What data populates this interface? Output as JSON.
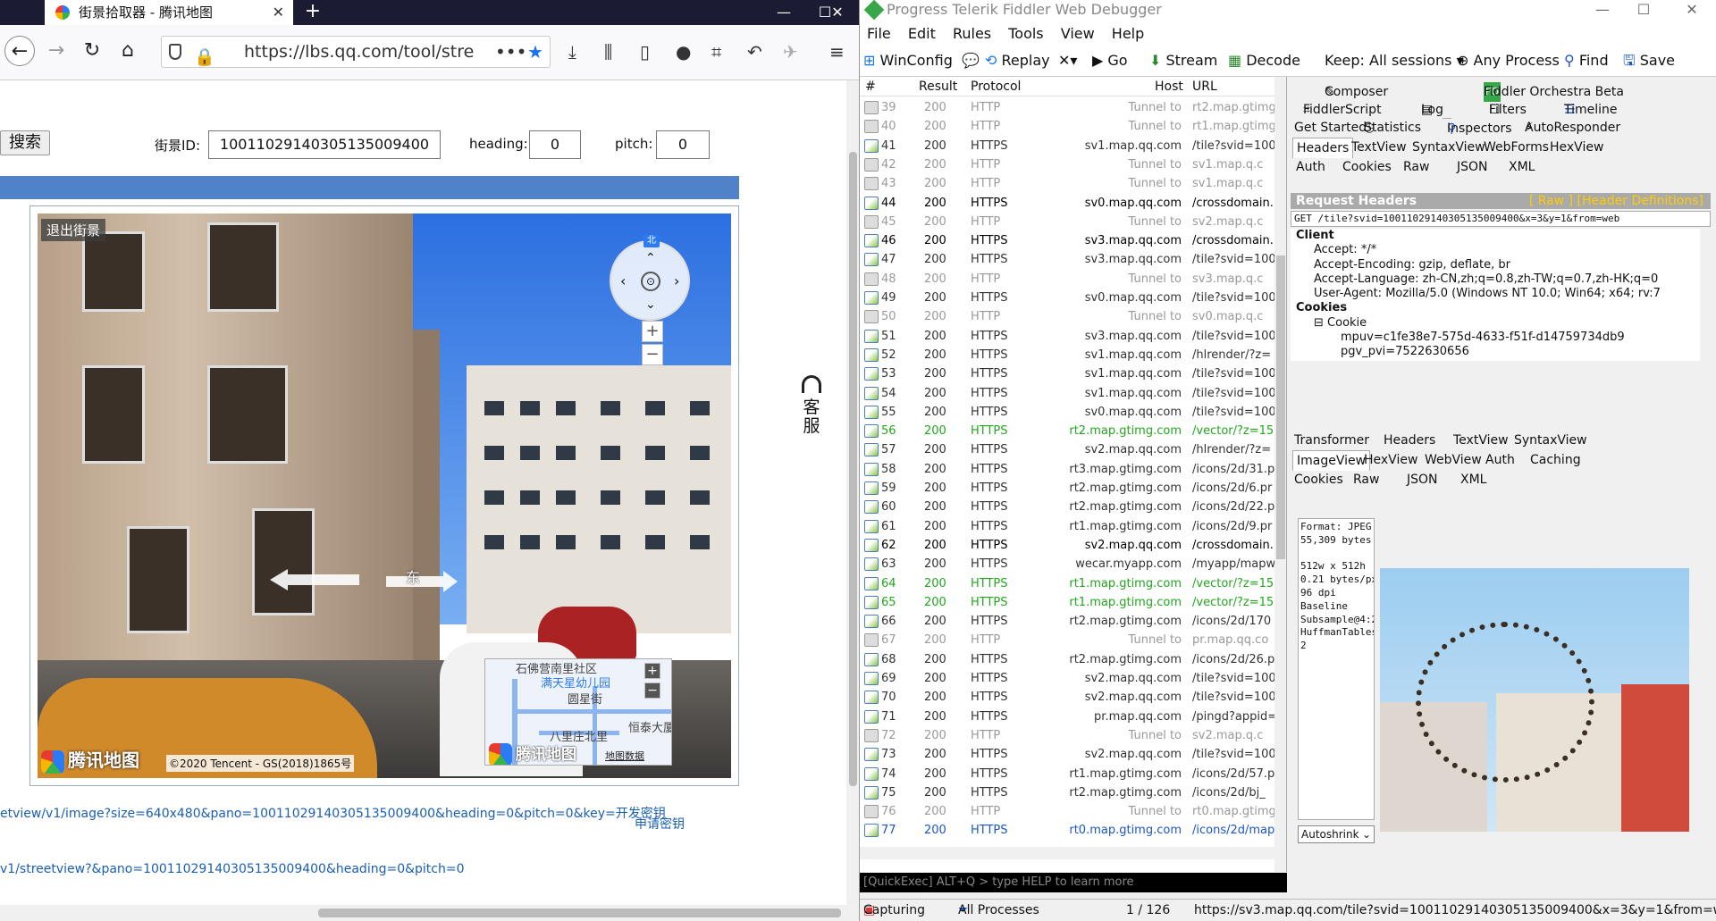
{
  "firefox": {
    "tab_title": "街景拾取器 - 腾讯地图",
    "url": "https://lbs.qq.com/tool/stre",
    "search_button": "搜索",
    "pano_id_label": "街景ID:",
    "pano_id_value": "10011029140305135009400",
    "heading_label": "heading:",
    "heading_value": "0",
    "pitch_label": "pitch:",
    "pitch_value": "0",
    "exit_streetview": "退出街景",
    "compass_north": "北",
    "direction_label": "东",
    "minimap_labels": [
      "石佛营南里社区",
      "满天星幼儿园",
      "圆星街",
      "八里庄北里",
      "恒泰大厦"
    ],
    "minimap_logo": "腾讯地图",
    "minimap_data": "地图数据",
    "pano_logo": "腾讯地图",
    "copyright": "©2020 Tencent - GS(2018)1865号",
    "kefu": "客服",
    "link_image": "etview/v1/image?size=640x480&pano=10011029140305135009400&heading=0&pitch=0&key=开发密钥",
    "link_apply": "申请密钥",
    "link_streetview": "v1/streetview?&pano=10011029140305135009400&heading=0&pitch=0"
  },
  "fiddler": {
    "title": "Progress Telerik Fiddler Web Debugger",
    "menu": [
      "File",
      "Edit",
      "Rules",
      "Tools",
      "View",
      "Help"
    ],
    "toolbar": {
      "winconfig": "WinConfig",
      "replay": "Replay",
      "go": "Go",
      "stream": "Stream",
      "decode": "Decode",
      "keep": "Keep: All sessions",
      "any_process": "Any Process",
      "find": "Find",
      "save": "Save"
    },
    "columns": [
      "#",
      "Result",
      "Protocol",
      "Host",
      "URL"
    ],
    "sessions": [
      {
        "n": "39",
        "r": "200",
        "p": "HTTP",
        "h": "Tunnel to",
        "u": "rt2.map.gtimg",
        "k": "t"
      },
      {
        "n": "40",
        "r": "200",
        "p": "HTTP",
        "h": "Tunnel to",
        "u": "rt1.map.gtimg",
        "k": "t"
      },
      {
        "n": "41",
        "r": "200",
        "p": "HTTPS",
        "h": "sv1.map.qq.com",
        "u": "/tile?svid=100",
        "k": "n"
      },
      {
        "n": "42",
        "r": "200",
        "p": "HTTP",
        "h": "Tunnel to",
        "u": "sv1.map.q.c",
        "k": "t"
      },
      {
        "n": "43",
        "r": "200",
        "p": "HTTP",
        "h": "Tunnel to",
        "u": "sv1.map.q.c",
        "k": "t"
      },
      {
        "n": "44",
        "r": "200",
        "p": "HTTPS",
        "h": "sv0.map.qq.com",
        "u": "/crossdomain.",
        "k": "b"
      },
      {
        "n": "45",
        "r": "200",
        "p": "HTTP",
        "h": "Tunnel to",
        "u": "sv2.map.q.c",
        "k": "t"
      },
      {
        "n": "46",
        "r": "200",
        "p": "HTTPS",
        "h": "sv3.map.qq.com",
        "u": "/crossdomain.",
        "k": "b"
      },
      {
        "n": "47",
        "r": "200",
        "p": "HTTPS",
        "h": "sv3.map.qq.com",
        "u": "/tile?svid=100",
        "k": "n"
      },
      {
        "n": "48",
        "r": "200",
        "p": "HTTP",
        "h": "Tunnel to",
        "u": "sv3.map.q.c",
        "k": "t"
      },
      {
        "n": "49",
        "r": "200",
        "p": "HTTPS",
        "h": "sv0.map.qq.com",
        "u": "/tile?svid=100",
        "k": "n"
      },
      {
        "n": "50",
        "r": "200",
        "p": "HTTP",
        "h": "Tunnel to",
        "u": "sv0.map.q.c",
        "k": "t"
      },
      {
        "n": "51",
        "r": "200",
        "p": "HTTPS",
        "h": "sv3.map.qq.com",
        "u": "/tile?svid=100",
        "k": "n"
      },
      {
        "n": "52",
        "r": "200",
        "p": "HTTPS",
        "h": "sv1.map.qq.com",
        "u": "/hlrender/?z=",
        "k": "n"
      },
      {
        "n": "53",
        "r": "200",
        "p": "HTTPS",
        "h": "sv1.map.qq.com",
        "u": "/tile?svid=100",
        "k": "n"
      },
      {
        "n": "54",
        "r": "200",
        "p": "HTTPS",
        "h": "sv1.map.qq.com",
        "u": "/tile?svid=100",
        "k": "n"
      },
      {
        "n": "55",
        "r": "200",
        "p": "HTTPS",
        "h": "sv0.map.qq.com",
        "u": "/tile?svid=100",
        "k": "n"
      },
      {
        "n": "56",
        "r": "200",
        "p": "HTTPS",
        "h": "rt2.map.gtimg.com",
        "u": "/vector/?z=15",
        "k": "g"
      },
      {
        "n": "57",
        "r": "200",
        "p": "HTTPS",
        "h": "sv2.map.qq.com",
        "u": "/hlrender/?z=",
        "k": "n"
      },
      {
        "n": "58",
        "r": "200",
        "p": "HTTPS",
        "h": "rt3.map.gtimg.com",
        "u": "/icons/2d/31.p",
        "k": "n"
      },
      {
        "n": "59",
        "r": "200",
        "p": "HTTPS",
        "h": "rt2.map.gtimg.com",
        "u": "/icons/2d/6.pr",
        "k": "n"
      },
      {
        "n": "60",
        "r": "200",
        "p": "HTTPS",
        "h": "rt2.map.gtimg.com",
        "u": "/icons/2d/22.p",
        "k": "n"
      },
      {
        "n": "61",
        "r": "200",
        "p": "HTTPS",
        "h": "rt1.map.gtimg.com",
        "u": "/icons/2d/9.pr",
        "k": "n"
      },
      {
        "n": "62",
        "r": "200",
        "p": "HTTPS",
        "h": "sv2.map.qq.com",
        "u": "/crossdomain.",
        "k": "b"
      },
      {
        "n": "63",
        "r": "200",
        "p": "HTTPS",
        "h": "wecar.myapp.com",
        "u": "/myapp/mapw",
        "k": "n"
      },
      {
        "n": "64",
        "r": "200",
        "p": "HTTPS",
        "h": "rt1.map.gtimg.com",
        "u": "/vector/?z=15",
        "k": "g"
      },
      {
        "n": "65",
        "r": "200",
        "p": "HTTPS",
        "h": "rt1.map.gtimg.com",
        "u": "/vector/?z=15",
        "k": "g"
      },
      {
        "n": "66",
        "r": "200",
        "p": "HTTPS",
        "h": "rt2.map.gtimg.com",
        "u": "/icons/2d/170",
        "k": "n"
      },
      {
        "n": "67",
        "r": "200",
        "p": "HTTP",
        "h": "Tunnel to",
        "u": "pr.map.qq.co",
        "k": "t"
      },
      {
        "n": "68",
        "r": "200",
        "p": "HTTPS",
        "h": "rt2.map.gtimg.com",
        "u": "/icons/2d/26.p",
        "k": "n"
      },
      {
        "n": "69",
        "r": "200",
        "p": "HTTPS",
        "h": "sv2.map.qq.com",
        "u": "/tile?svid=100",
        "k": "n"
      },
      {
        "n": "70",
        "r": "200",
        "p": "HTTPS",
        "h": "sv2.map.qq.com",
        "u": "/tile?svid=100",
        "k": "n"
      },
      {
        "n": "71",
        "r": "200",
        "p": "HTTPS",
        "h": "pr.map.qq.com",
        "u": "/pingd?appid=",
        "k": "n"
      },
      {
        "n": "72",
        "r": "200",
        "p": "HTTP",
        "h": "Tunnel to",
        "u": "sv2.map.q.c",
        "k": "t"
      },
      {
        "n": "73",
        "r": "200",
        "p": "HTTPS",
        "h": "sv2.map.qq.com",
        "u": "/tile?svid=100",
        "k": "n"
      },
      {
        "n": "74",
        "r": "200",
        "p": "HTTPS",
        "h": "rt1.map.gtimg.com",
        "u": "/icons/2d/57.p",
        "k": "n"
      },
      {
        "n": "75",
        "r": "200",
        "p": "HTTPS",
        "h": "rt2.map.gtimg.com",
        "u": "/icons/2d/bj_",
        "k": "n"
      },
      {
        "n": "76",
        "r": "200",
        "p": "HTTP",
        "h": "Tunnel to",
        "u": "rt0.map.gtimg",
        "k": "t"
      },
      {
        "n": "77",
        "r": "200",
        "p": "HTTPS",
        "h": "rt0.map.gtimg.com",
        "u": "/icons/2d/map",
        "k": "sel"
      }
    ],
    "quickexec": "[QuickExec] ALT+Q > type HELP to learn more",
    "status": {
      "capturing": "Capturing",
      "processes": "All Processes",
      "count": "1 / 126",
      "url": "https://sv3.map.qq.com/tile?svid=10011029140305135009400&x=3&y=1&from=web&level="
    },
    "insp_tabs_row1": [
      "Composer",
      "Fiddler Orchestra Beta"
    ],
    "insp_tabs_row2": [
      "FiddlerScript",
      "Log",
      "Filters",
      "Timeline"
    ],
    "insp_tabs_row3": [
      "Get Started",
      "Statistics",
      "Inspectors",
      "AutoResponder"
    ],
    "req_tabs": [
      "Headers",
      "TextView",
      "SyntaxView",
      "WebForms",
      "HexView"
    ],
    "req_tabs2": [
      "Auth",
      "Cookies",
      "Raw",
      "JSON",
      "XML"
    ],
    "req_header_title": "Request Headers",
    "req_header_links": "[ Raw ]   [Header Definitions]",
    "req_line": "GET /tile?svid=10011029140305135009400&x=3&y=1&from=web",
    "tree": {
      "client": "Client",
      "accept": "Accept: */*",
      "accept_encoding": "Accept-Encoding: gzip, deflate, br",
      "accept_language": "Accept-Language: zh-CN,zh;q=0.8,zh-TW;q=0.7,zh-HK;q=0",
      "user_agent": "User-Agent: Mozilla/5.0 (Windows NT 10.0; Win64; x64; rv:7",
      "cookies": "Cookies",
      "cookie": "Cookie",
      "mpuv": "mpuv=c1fe38e7-575d-4633-f51f-d14759734db9",
      "pgv": "pgv_pvi=7522630656"
    },
    "resp_tabs": [
      "Transformer",
      "Headers",
      "TextView",
      "SyntaxView"
    ],
    "resp_tabs2": [
      "ImageView",
      "HexView",
      "WebView",
      "Auth",
      "Caching"
    ],
    "resp_tabs3": [
      "Cookies",
      "Raw",
      "JSON",
      "XML"
    ],
    "image_info": "Format: JPEG\n55,309 bytes\n\n512w x 512h\n0.21 bytes/px\n96 dpi\nBaseline\nSubsample@4:2:0\nHuffmanTables:\n2",
    "autoshrink": "Autoshrink"
  }
}
